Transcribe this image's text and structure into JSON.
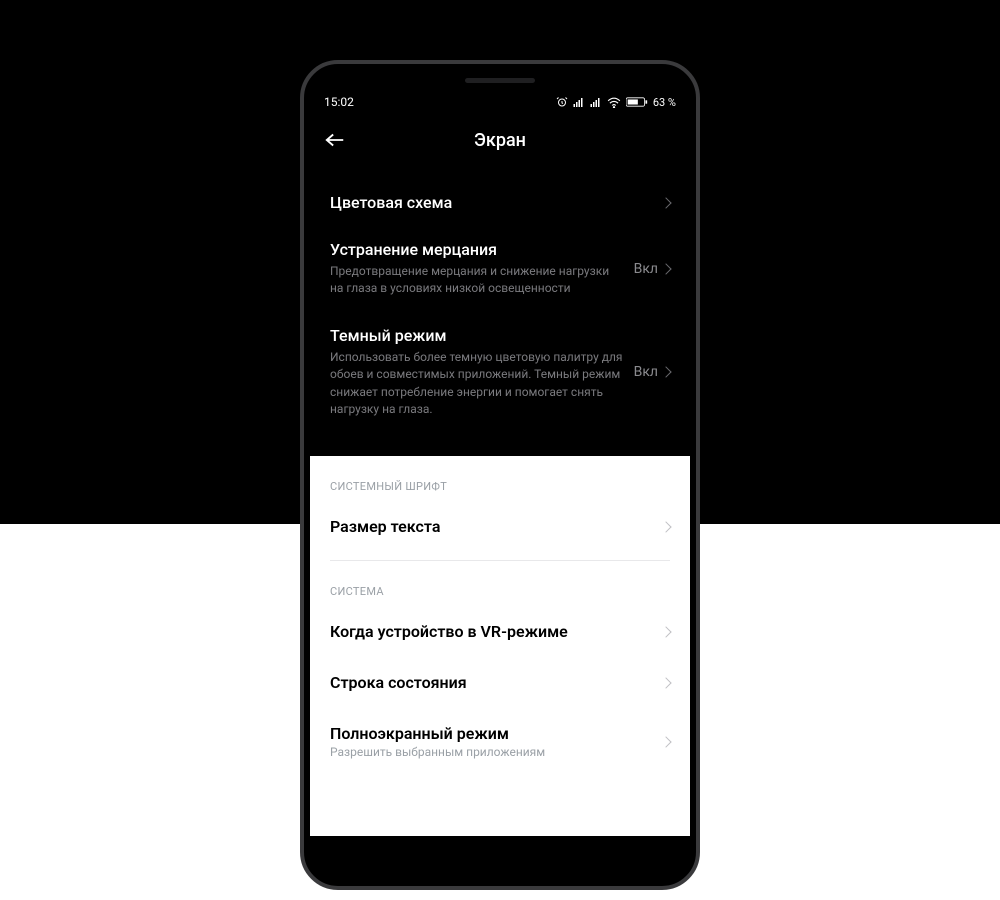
{
  "statusbar": {
    "time": "15:02",
    "battery": "63 %"
  },
  "header": {
    "title": "Экран"
  },
  "dark": {
    "color_scheme": {
      "label": "Цветовая схема"
    },
    "flicker": {
      "label": "Устранение мерцания",
      "desc": "Предотвращение мерцания и снижение нагрузки на глаза в условиях низкой освещенности",
      "value": "Вкл"
    },
    "dark_mode": {
      "label": "Темный режим",
      "desc": "Использовать более темную цветовую палитру для обоев и совместимых приложений. Темный режим снижает потребление энергии и помогает снять нагрузку на глаза.",
      "value": "Вкл"
    }
  },
  "light": {
    "section_font": "СИСТЕМНЫЙ ШРИФТ",
    "text_size": {
      "label": "Размер текста"
    },
    "section_system": "СИСТЕМА",
    "vr": {
      "label": "Когда устройство в VR-режиме"
    },
    "statusline": {
      "label": "Строка состояния"
    },
    "fullscreen": {
      "label": "Полноэкранный режим",
      "desc": "Разрешить выбранным приложениям"
    }
  }
}
